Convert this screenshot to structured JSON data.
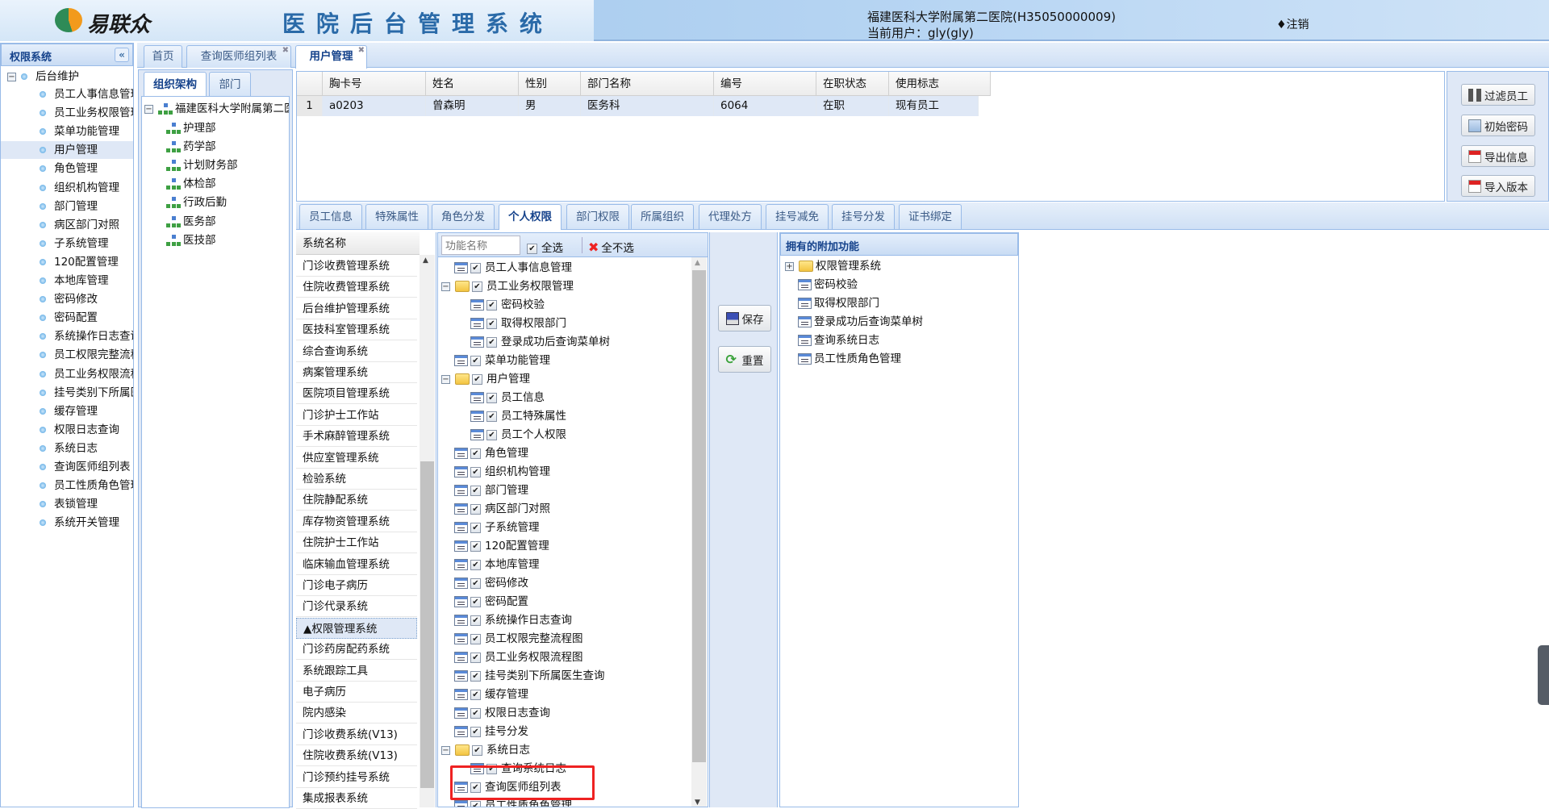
{
  "header": {
    "logo_text": "易联众",
    "system_title": "医院后台管理系统",
    "hospital": "福建医科大学附属第二医院(H35050000009)",
    "current_user": "当前用户：gly(gly)",
    "logout": "♦注销"
  },
  "left_panel": {
    "title": "权限系统",
    "collapse": "«",
    "root": "后台维护",
    "items": [
      "员工人事信息管理",
      "员工业务权限管理",
      "菜单功能管理",
      "用户管理",
      "角色管理",
      "组织机构管理",
      "部门管理",
      "病区部门对照",
      "子系统管理",
      "120配置管理",
      "本地库管理",
      "密码修改",
      "密码配置",
      "系统操作日志查询",
      "员工权限完整流程图",
      "员工业务权限流程图",
      "挂号类别下所属医生查询",
      "缓存管理",
      "权限日志查询",
      "系统日志",
      "查询医师组列表",
      "员工性质角色管理",
      "表锁管理",
      "系统开关管理"
    ],
    "selected_index": 3
  },
  "tabs": [
    {
      "label": "首页",
      "closable": false
    },
    {
      "label": "查询医师组列表",
      "closable": true
    },
    {
      "label": "用户管理",
      "closable": true,
      "active": true
    }
  ],
  "org": {
    "tabs": [
      "组织架构",
      "部门"
    ],
    "root": "福建医科大学附属第二医院",
    "children": [
      "护理部",
      "药学部",
      "计划财务部",
      "体检部",
      "行政后勤",
      "医务部",
      "医技部"
    ]
  },
  "grid": {
    "columns": [
      "",
      "胸卡号",
      "姓名",
      "性别",
      "部门名称",
      "编号",
      "在职状态",
      "使用标志"
    ],
    "rows": [
      [
        "1",
        "a0203",
        "曾森明",
        "男",
        "医务科",
        "6064",
        "在职",
        "现有员工"
      ]
    ]
  },
  "actions": [
    "过滤员工",
    "初始密码",
    "导出信息",
    "导入版本"
  ],
  "sub_tabs": [
    "员工信息",
    "特殊属性",
    "角色分发",
    "个人权限",
    "部门权限",
    "所属组织",
    "代理处方",
    "挂号减免",
    "挂号分发",
    "证书绑定"
  ],
  "sub_tab_active": 3,
  "systems": {
    "header": "系统名称",
    "items": [
      "门诊收费管理系统",
      "住院收费管理系统",
      "后台维护管理系统",
      "医技科室管理系统",
      "综合查询系统",
      "病案管理系统",
      "医院项目管理系统",
      "门诊护士工作站",
      "手术麻醉管理系统",
      "供应室管理系统",
      "检验系统",
      "住院静配系统",
      "库存物资管理系统",
      "住院护士工作站",
      "临床输血管理系统",
      "门诊电子病历",
      "门诊代录系统",
      "▲权限管理系统",
      "门诊药房配药系统",
      "系统跟踪工具",
      "电子病历",
      "院内感染",
      "门诊收费系统(V13)",
      "住院收费系统(V13)",
      "门诊预约挂号系统",
      "集成报表系统"
    ],
    "selected_index": 17
  },
  "functions": {
    "search_placeholder": "功能名称",
    "select_all": "全选",
    "select_none": "全不选",
    "items": [
      {
        "label": "员工人事信息管理",
        "level": 0,
        "type": "doc",
        "checked": true
      },
      {
        "label": "员工业务权限管理",
        "level": 0,
        "type": "folder",
        "checked": true
      },
      {
        "label": "密码校验",
        "level": 1,
        "type": "doc",
        "checked": true
      },
      {
        "label": "取得权限部门",
        "level": 1,
        "type": "doc",
        "checked": true
      },
      {
        "label": "登录成功后查询菜单树",
        "level": 1,
        "type": "doc",
        "checked": true
      },
      {
        "label": "菜单功能管理",
        "level": 0,
        "type": "doc",
        "checked": true
      },
      {
        "label": "用户管理",
        "level": 0,
        "type": "folder",
        "checked": true
      },
      {
        "label": "员工信息",
        "level": 1,
        "type": "doc",
        "checked": true
      },
      {
        "label": "员工特殊属性",
        "level": 1,
        "type": "doc",
        "checked": true
      },
      {
        "label": "员工个人权限",
        "level": 1,
        "type": "doc",
        "checked": true
      },
      {
        "label": "角色管理",
        "level": 0,
        "type": "doc",
        "checked": true
      },
      {
        "label": "组织机构管理",
        "level": 0,
        "type": "doc",
        "checked": true
      },
      {
        "label": "部门管理",
        "level": 0,
        "type": "doc",
        "checked": true
      },
      {
        "label": "病区部门对照",
        "level": 0,
        "type": "doc",
        "checked": true
      },
      {
        "label": "子系统管理",
        "level": 0,
        "type": "doc",
        "checked": true
      },
      {
        "label": "120配置管理",
        "level": 0,
        "type": "doc",
        "checked": true
      },
      {
        "label": "本地库管理",
        "level": 0,
        "type": "doc",
        "checked": true
      },
      {
        "label": "密码修改",
        "level": 0,
        "type": "doc",
        "checked": true
      },
      {
        "label": "密码配置",
        "level": 0,
        "type": "doc",
        "checked": true
      },
      {
        "label": "系统操作日志查询",
        "level": 0,
        "type": "doc",
        "checked": true
      },
      {
        "label": "员工权限完整流程图",
        "level": 0,
        "type": "doc",
        "checked": true
      },
      {
        "label": "员工业务权限流程图",
        "level": 0,
        "type": "doc",
        "checked": true
      },
      {
        "label": "挂号类别下所属医生查询",
        "level": 0,
        "type": "doc",
        "checked": true
      },
      {
        "label": "缓存管理",
        "level": 0,
        "type": "doc",
        "checked": true
      },
      {
        "label": "权限日志查询",
        "level": 0,
        "type": "doc",
        "checked": true
      },
      {
        "label": "挂号分发",
        "level": 0,
        "type": "doc",
        "checked": true
      },
      {
        "label": "系统日志",
        "level": 0,
        "type": "folder",
        "checked": true
      },
      {
        "label": "查询系统日志",
        "level": 1,
        "type": "doc",
        "checked": true
      },
      {
        "label": "查询医师组列表",
        "level": 0,
        "type": "doc",
        "checked": true
      },
      {
        "label": "员工性质角色管理",
        "level": 0,
        "type": "doc",
        "checked": true
      }
    ]
  },
  "buttons": {
    "save": "保存",
    "reset": "重置"
  },
  "owned": {
    "title": "拥有的附加功能",
    "root": "权限管理系统",
    "items": [
      "密码校验",
      "取得权限部门",
      "登录成功后查询菜单树",
      "查询系统日志",
      "员工性质角色管理"
    ]
  },
  "colors": {
    "highlight_box": "#ee2222",
    "panel_border": "#99bbe8"
  }
}
